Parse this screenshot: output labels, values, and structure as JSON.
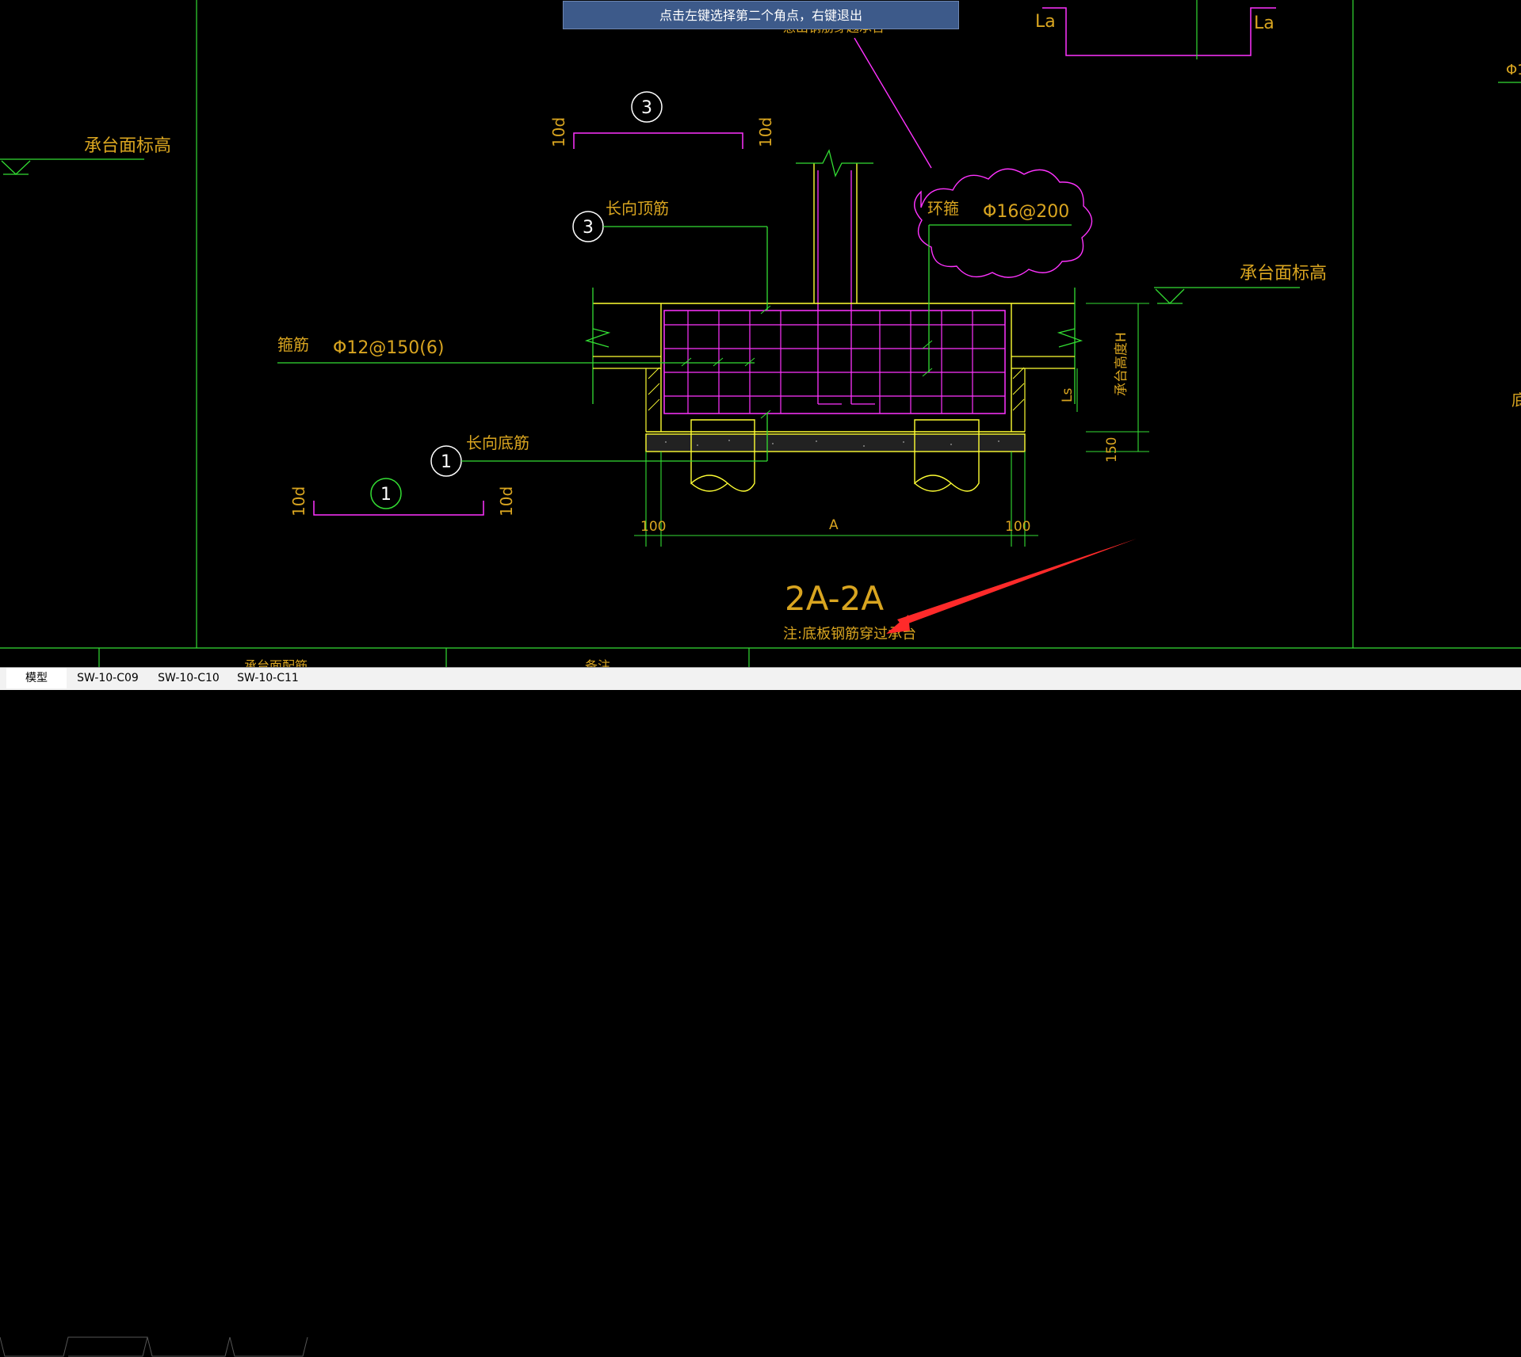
{
  "prompt": {
    "message": "点击左键选择第二个角点，右键退出"
  },
  "tabs": [
    {
      "label": "模型",
      "active": true
    },
    {
      "label": "SW-10-C09",
      "active": false
    },
    {
      "label": "SW-10-C10",
      "active": false
    },
    {
      "label": "SW-10-C11",
      "active": false
    }
  ],
  "drawing": {
    "section_title": "2A-2A",
    "note": "注:底板钢筋穿过承台",
    "labels": {
      "la_left": "La",
      "la_right": "La",
      "top_cut_label": "悬出钢筋穿越承台",
      "cap_top_elev_left": "承台面标高",
      "cap_top_elev_right": "承台面标高",
      "hoop_label": "箍筋",
      "hoop_spec": "Φ12@150(6)",
      "ring_label": "环箍",
      "ring_spec": "Φ16@200",
      "long_top_label": "长向顶筋",
      "long_bottom_label": "长向底筋",
      "cap_height": "承台高度H",
      "ls": "Ls",
      "dim_150": "150",
      "dim_100_left": "100",
      "dim_100_right": "100",
      "dim_a": "A",
      "ten_d": "10d",
      "right_edge_phi": "Φ1",
      "right_edge_text": "底",
      "footer_cap_rebar": "承台面配筋",
      "footer_remark": "备注"
    },
    "bubbles": {
      "bar3": "3",
      "bar1": "1"
    }
  },
  "colors": {
    "background": "#000000",
    "yellow": "#ffff33",
    "green": "#33dd33",
    "magenta": "#ff33ff",
    "orange_text": "#d9a520",
    "white": "#ffffff",
    "red_arrow": "#ff2a2a",
    "prompt_bg": "#3d5a8a"
  }
}
